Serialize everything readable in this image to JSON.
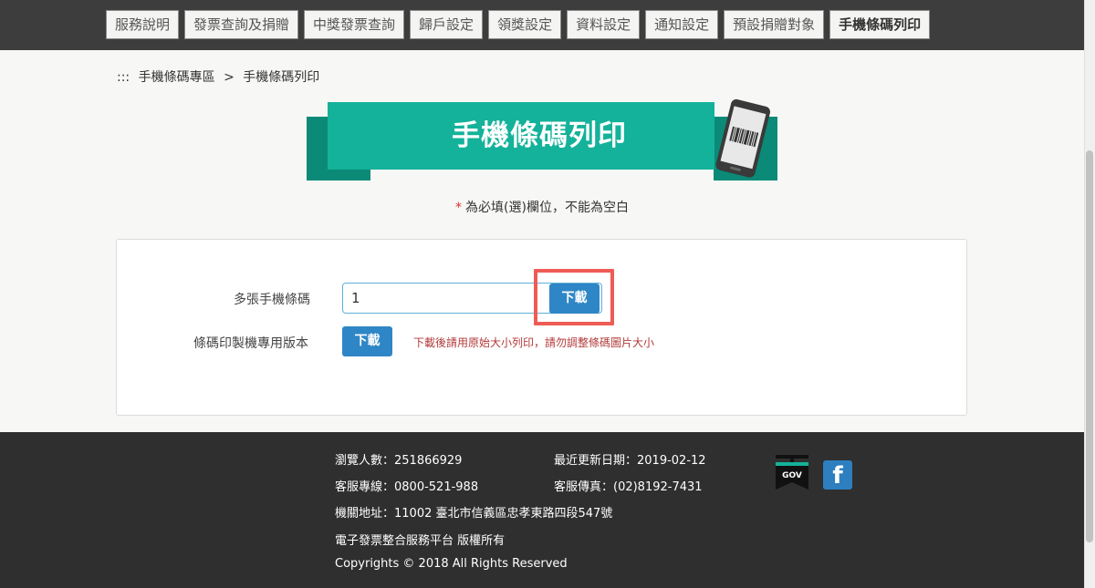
{
  "nav": {
    "items": [
      {
        "label": "服務說明"
      },
      {
        "label": "發票查詢及捐贈"
      },
      {
        "label": "中獎發票查詢"
      },
      {
        "label": "歸戶設定"
      },
      {
        "label": "領獎設定"
      },
      {
        "label": "資料設定"
      },
      {
        "label": "通知設定"
      },
      {
        "label": "預設捐贈對象"
      },
      {
        "label": "手機條碼列印"
      }
    ],
    "active_index": 8
  },
  "breadcrumb": {
    "prefix": ":::",
    "section": "手機條碼專區",
    "separator": ">",
    "current": "手機條碼列印"
  },
  "banner": {
    "title": "手機條碼列印",
    "icon": "phone-barcode-icon"
  },
  "required_note": {
    "star": "*",
    "text": "為必填(選)欄位，不能為空白"
  },
  "form": {
    "multi_barcode_label": "多張手機條碼",
    "multi_barcode_value": "1",
    "download_label": "下載",
    "printer_version_label": "條碼印製機專用版本",
    "printer_download_label": "下載",
    "printer_warning": "下載後請用原始大小列印，請勿調整條碼圖片大小"
  },
  "footer": {
    "visitors": "瀏覽人數：251866929",
    "updated": "最近更新日期：2019-02-12",
    "hotline": "客服專線：0800-521-988",
    "fax": "客服傳真：(02)8192-7431",
    "address": "機關地址：11002 臺北市信義區忠孝東路四段547號",
    "platform": "電子發票整合服務平台 版權所有",
    "copyright": "Copyrights © 2018 All Rights Reserved",
    "gov_label": "GOV",
    "fb_label": "f"
  },
  "colors": {
    "nav_bg": "#3d3d3d",
    "banner_teal": "#14b29a",
    "banner_dark_teal": "#0b8a77",
    "button_blue": "#2f86c6",
    "highlight_red": "#ef5b55",
    "warning_red": "#b23a3a",
    "footer_bg": "#2f2f2f"
  }
}
